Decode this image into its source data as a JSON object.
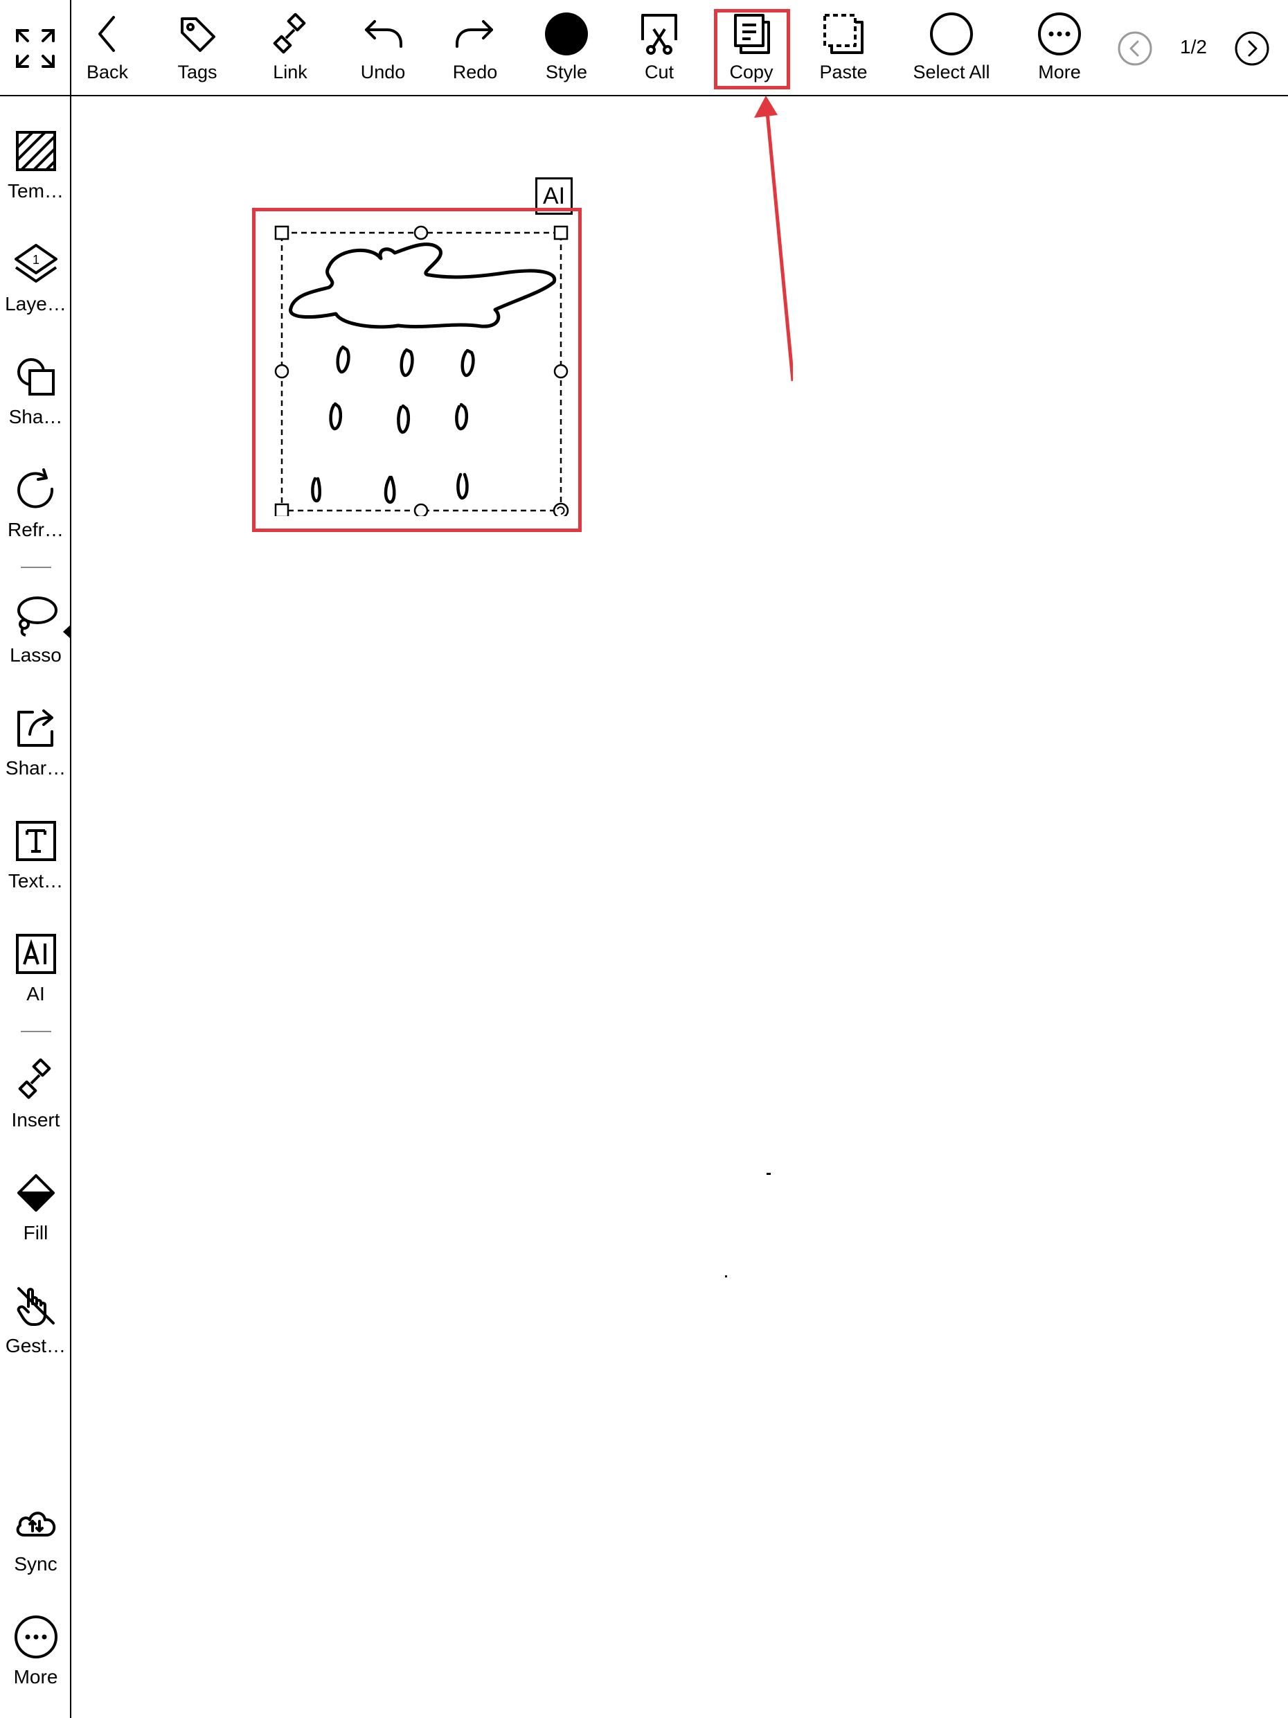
{
  "toolbar": {
    "items": [
      {
        "label": "Back",
        "icon": "chevron-left-icon"
      },
      {
        "label": "Tags",
        "icon": "tag-icon"
      },
      {
        "label": "Link",
        "icon": "link-icon"
      },
      {
        "label": "Undo",
        "icon": "undo-icon"
      },
      {
        "label": "Redo",
        "icon": "redo-icon"
      },
      {
        "label": "Style",
        "icon": "filled-circle-icon"
      },
      {
        "label": "Cut",
        "icon": "scissors-icon"
      },
      {
        "label": "Copy",
        "icon": "copy-icon"
      },
      {
        "label": "Paste",
        "icon": "paste-icon"
      },
      {
        "label": "Select All",
        "icon": "circle-outline-icon"
      },
      {
        "label": "More",
        "icon": "more-dots-icon"
      }
    ],
    "page_indicator": "1/2"
  },
  "sidebar": {
    "items": [
      {
        "label": "Tem…",
        "icon": "template-hatch-icon"
      },
      {
        "label": "Laye…",
        "icon": "layers-icon"
      },
      {
        "label": "Sha…",
        "icon": "shapes-icon"
      },
      {
        "label": "Refr…",
        "icon": "refresh-icon"
      },
      {
        "label": "Lasso",
        "icon": "lasso-icon"
      },
      {
        "label": "Shar…",
        "icon": "share-icon"
      },
      {
        "label": "Text…",
        "icon": "text-box-icon"
      },
      {
        "label": "AI",
        "icon": "ai-box-icon"
      },
      {
        "label": "Insert",
        "icon": "link-insert-icon"
      },
      {
        "label": "Fill",
        "icon": "fill-bucket-icon"
      },
      {
        "label": "Gest…",
        "icon": "gesture-hand-icon"
      },
      {
        "label": "Sync",
        "icon": "cloud-sync-icon"
      },
      {
        "label": "More",
        "icon": "more-dots-icon"
      }
    ]
  },
  "canvas": {
    "ai_badge": "AI",
    "selection_content": "hand-drawn cloud with raindrops"
  },
  "annotation": {
    "highlight_color": "#e0383e",
    "highlighted_tool": "Copy"
  }
}
